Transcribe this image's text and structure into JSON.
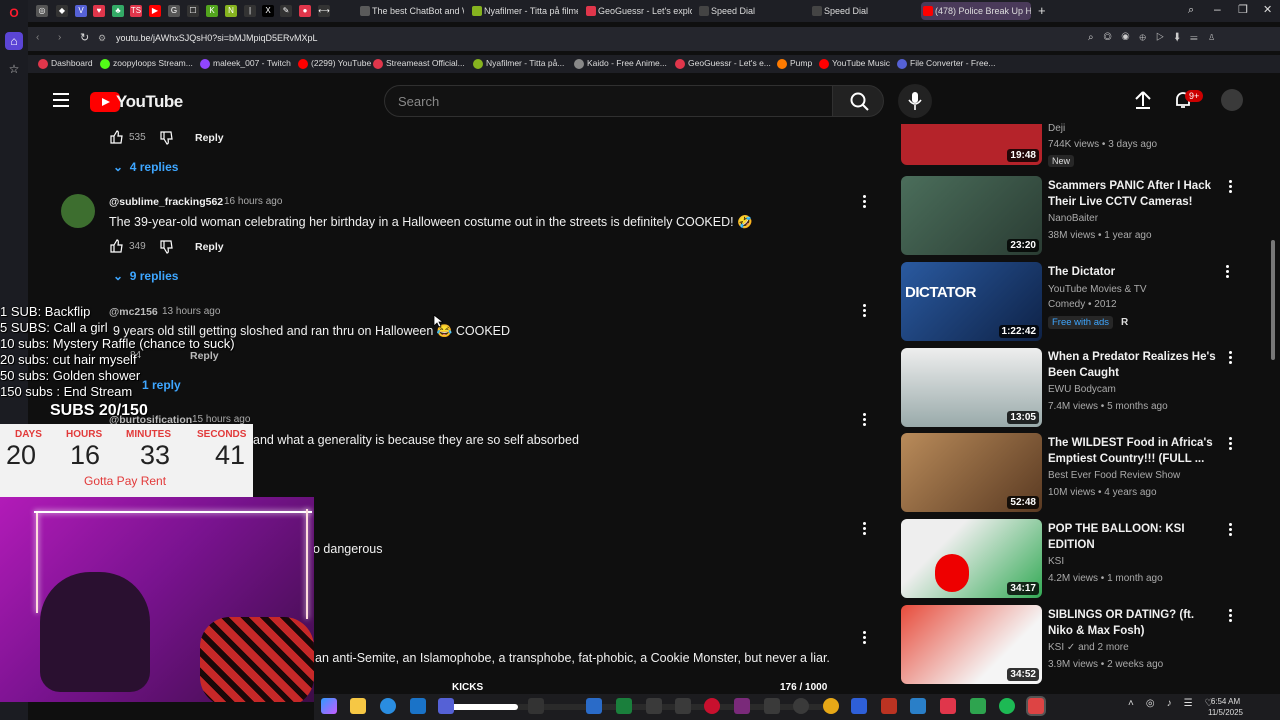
{
  "browser": {
    "tabs": [
      {
        "label": "The best ChatBot and Wi",
        "color": "#5a5a5a"
      },
      {
        "label": "Nyafilmer - Titta på filmer",
        "color": "#86b31f"
      },
      {
        "label": "GeoGuessr - Let's explore",
        "color": "#e0364b"
      },
      {
        "label": "Speed Dial",
        "color": "#444"
      },
      {
        "label": "Speed Dial",
        "color": "#444"
      },
      {
        "label": "(478) Police Break Up HE",
        "color": "#ff0000"
      }
    ],
    "url": "youtu.be/jAWhxSJQsH0?si=bMJMpiqD5ERvMXpL",
    "bookmarks": [
      {
        "label": "Dashboard",
        "color": "#e0364b"
      },
      {
        "label": "zoopyloops Stream...",
        "color": "#53fc18"
      },
      {
        "label": "maleek_007 - Twitch",
        "color": "#9146ff"
      },
      {
        "label": "(2299) YouTube",
        "color": "#ff0000"
      },
      {
        "label": "Streameast Official...",
        "color": "#e0364b"
      },
      {
        "label": "Nyafilmer - Titta på...",
        "color": "#86b31f"
      },
      {
        "label": "Kaido - Free Anime...",
        "color": "#888"
      },
      {
        "label": "GeoGuessr - Let's e...",
        "color": "#e0364b"
      },
      {
        "label": "Pump",
        "color": "#ff7b00"
      },
      {
        "label": "YouTube Music",
        "color": "#ff0000"
      },
      {
        "label": "File Converter - Free...",
        "color": "#5561d6"
      }
    ]
  },
  "youtube": {
    "logo_text": "YouTube",
    "search_placeholder": "Search",
    "notif_badge": "9+"
  },
  "comments": [
    {
      "likes": "535",
      "reply_label": "Reply",
      "replies_label": "4 replies"
    },
    {
      "handle": "@sublime_fracking562",
      "time": "16 hours ago",
      "text": "The 39-year-old woman celebrating her birthday in a Halloween costume out in the streets is definitely COOKED! 🤣",
      "likes": "349",
      "reply_label": "Reply",
      "replies_label": "9 replies"
    },
    {
      "handle": "@mc2156",
      "time": "13 hours ago",
      "text": "9 years old still getting sloshed and ran thru on Halloween 😂 COOKED",
      "likes": "84",
      "reply_label": "Reply",
      "replies_label": "1 reply"
    },
    {
      "handle": "@burtosification",
      "time": "15 hours ago",
      "text": "and what a generality is because they are so self absorbed"
    },
    {
      "text": "o dangerous"
    },
    {
      "text": "an anti-Semite, an Islamophobe, a transphobe, fat-phobic, a Cookie Monster, but never a liar."
    }
  ],
  "recommendations": [
    {
      "title": "",
      "channel": "Deji",
      "meta": "744K views • 3 days ago",
      "badge": "New",
      "duration": "19:48",
      "thumb_color": "#b5232a"
    },
    {
      "title": "Scammers PANIC After I Hack Their Live CCTV Cameras!",
      "channel": "NanoBaiter",
      "meta": "38M views • 1 year ago",
      "duration": "23:20",
      "thumb_color": "#3b5c4a"
    },
    {
      "title": "The Dictator",
      "channel": "YouTube Movies & TV",
      "meta": "Comedy • 2012",
      "badge": "Free with ads",
      "rating": "R",
      "duration": "1:22:42",
      "thumb_color": "#1e3d70",
      "thumb_text": "DICTATOR"
    },
    {
      "title": "When a Predator Realizes He's Been Caught",
      "channel": "EWU Bodycam",
      "meta": "7.4M views • 5 months ago",
      "duration": "13:05",
      "thumb_color": "#d9d9d9"
    },
    {
      "title": "The WILDEST Food in Africa's Emptiest Country!!! (FULL ...",
      "channel": "Best Ever Food Review Show",
      "meta": "10M views • 4 years ago",
      "duration": "52:48",
      "thumb_color": "#8a5a3a"
    },
    {
      "title": "POP THE BALLOON: KSI EDITION",
      "channel": "KSI",
      "meta": "4.2M views • 1 month ago",
      "duration": "34:17",
      "thumb_color": "#2a8a3a"
    },
    {
      "title": "SIBLINGS OR DATING? (ft. Niko & Max Fosh)",
      "channel": "KSI",
      "channel_extra": "and 2 more",
      "meta": "3.9M views • 2 weeks ago",
      "duration": "34:52",
      "thumb_color": "#c0392b"
    }
  ],
  "stream_overlay": {
    "goals": [
      "1 SUB: Backflip",
      "5 SUBS: Call a girl",
      "10 subs: Mystery Raffle (chance to suck)",
      "20 subs: cut hair myself",
      "50 subs: Golden shower",
      "150 subs : End Stream"
    ],
    "subs_count": "SUBS 20/150",
    "timer_labels": [
      "DAYS",
      "HOURS",
      "MINUTES",
      "SECONDS"
    ],
    "timer_values": [
      "20",
      "16",
      "33",
      "41"
    ],
    "timer_caption": "Gotta Pay Rent",
    "kicks_label": "KICKS",
    "kicks_count": "176  / 1000",
    "kicks_progress": 0.176
  },
  "taskbar": {
    "time": "6:54 AM",
    "date": "11/5/2025"
  }
}
